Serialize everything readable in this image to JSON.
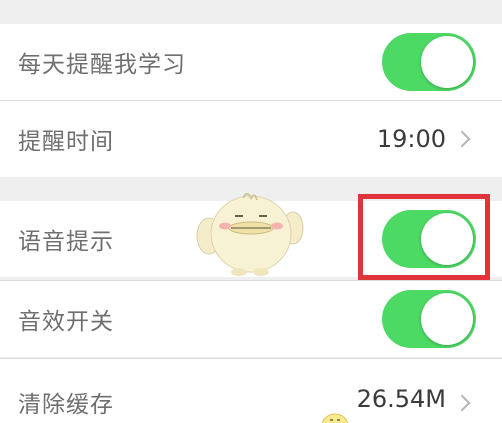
{
  "settings": {
    "daily_reminder": {
      "label": "每天提醒我学习",
      "enabled": true
    },
    "reminder_time": {
      "label": "提醒时间",
      "value": "19:00"
    },
    "voice_prompt": {
      "label": "语音提示",
      "enabled": true
    },
    "sound_effects": {
      "label": "音效开关",
      "enabled": true
    },
    "clear_cache": {
      "label": "清除缓存",
      "value": "26.54M"
    }
  },
  "colors": {
    "toggle_on": "#4cd964",
    "highlight_border": "#e0333a",
    "section_gap": "#efefef"
  },
  "icons": {
    "chevron": "chevron-right-icon",
    "mascot": "chick-mascot-icon"
  }
}
